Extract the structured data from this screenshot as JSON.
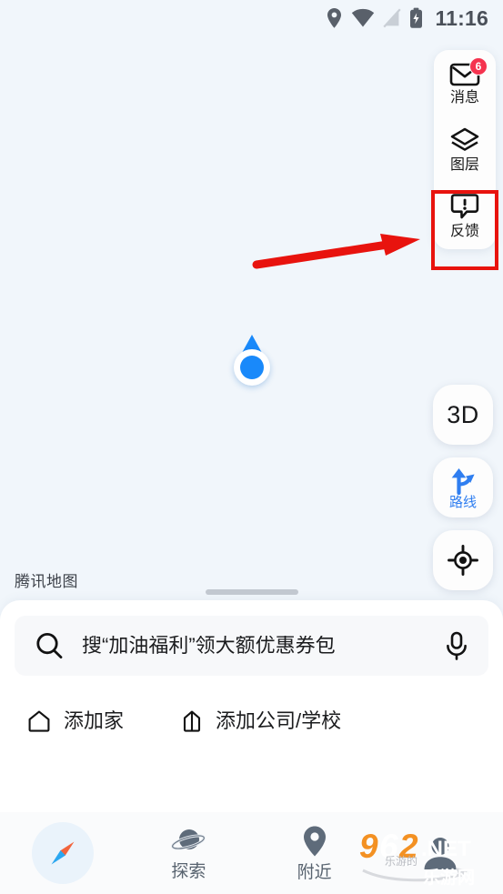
{
  "app": {
    "name": "腾讯地图",
    "map_attribution": "腾讯地图"
  },
  "status_bar": {
    "time": "11:16",
    "icons": [
      "location-pin-icon",
      "wifi-icon",
      "signal-off-icon",
      "battery-charging-icon"
    ]
  },
  "map": {
    "background_color": "#f1f6fb",
    "user_location_marker": "current-location-puck"
  },
  "tool_panel": {
    "items": [
      {
        "id": "messages",
        "label": "消息",
        "icon": "envelope-icon",
        "badge": "6"
      },
      {
        "id": "layers",
        "label": "图层",
        "icon": "layers-icon",
        "badge": ""
      },
      {
        "id": "feedback",
        "label": "反馈",
        "icon": "feedback-bubble-icon",
        "badge": "",
        "highlighted": true
      }
    ]
  },
  "annotation": {
    "arrow_color": "#e8130e",
    "highlight_color": "#e8130e",
    "points_to": "反馈"
  },
  "floating_buttons": [
    {
      "id": "3d",
      "label": "3D",
      "icon": ""
    },
    {
      "id": "route",
      "label": "路线",
      "icon": "route-arrow-icon"
    },
    {
      "id": "locate",
      "label": "",
      "icon": "crosshair-icon"
    }
  ],
  "bottom_sheet": {
    "drag_handle": "sheet-drag-handle",
    "search": {
      "icon": "search-icon",
      "placeholder": "搜“加油福利”领大额优惠券包",
      "value": "",
      "voice_icon": "microphone-icon"
    },
    "shortcuts": [
      {
        "id": "home",
        "label": "添加家",
        "icon": "home-icon"
      },
      {
        "id": "work",
        "label": "添加公司/学校",
        "icon": "briefcase-icon"
      }
    ]
  },
  "bottom_nav": {
    "active_index": 0,
    "items": [
      {
        "id": "compass",
        "label": "",
        "icon": "compass-needle-icon"
      },
      {
        "id": "explore",
        "label": "探索",
        "icon": "planet-icon"
      },
      {
        "id": "nearby",
        "label": "附近",
        "icon": "map-pin-icon"
      },
      {
        "id": "profile",
        "label": "",
        "icon": "user-avatar-icon"
      }
    ]
  },
  "watermark": {
    "text": "962.NET",
    "sub_text": "乐游网"
  }
}
